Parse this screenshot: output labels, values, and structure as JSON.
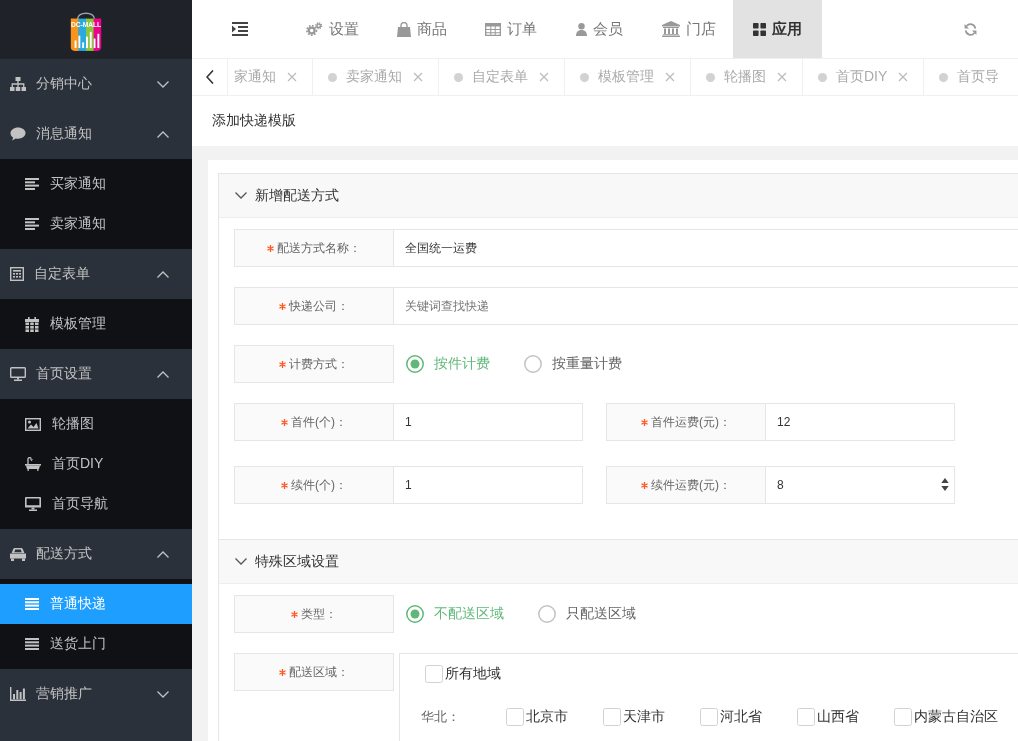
{
  "logo": {
    "text": "DC-MALL"
  },
  "sidebar": {
    "groups": [
      {
        "label": "分销中心",
        "expanded": false
      },
      {
        "label": "消息通知",
        "expanded": true,
        "children": [
          {
            "label": "买家通知",
            "selected": false
          },
          {
            "label": "卖家通知",
            "selected": false
          }
        ]
      },
      {
        "label": "自定表单",
        "expanded": true,
        "children": [
          {
            "label": "模板管理",
            "selected": false
          }
        ]
      },
      {
        "label": "首页设置",
        "expanded": true,
        "children": [
          {
            "label": "轮播图",
            "selected": false
          },
          {
            "label": "首页DIY",
            "selected": false
          },
          {
            "label": "首页导航",
            "selected": false
          }
        ]
      },
      {
        "label": "配送方式",
        "expanded": true,
        "children": [
          {
            "label": "普通快递",
            "selected": true
          },
          {
            "label": "送货上门",
            "selected": false
          }
        ]
      },
      {
        "label": "营销推广",
        "expanded": false
      }
    ]
  },
  "topnav": {
    "items": [
      {
        "label": "设置",
        "selected": false
      },
      {
        "label": "商品",
        "selected": false
      },
      {
        "label": "订单",
        "selected": false
      },
      {
        "label": "会员",
        "selected": false
      },
      {
        "label": "门店",
        "selected": false
      },
      {
        "label": "应用",
        "selected": true
      }
    ]
  },
  "tabs": [
    {
      "kind": "cut-left",
      "label": "家通知",
      "selected": false
    },
    {
      "kind": "full",
      "label": "卖家通知",
      "selected": false
    },
    {
      "kind": "full",
      "label": "自定表单",
      "selected": false
    },
    {
      "kind": "full",
      "label": "模板管理",
      "selected": false
    },
    {
      "kind": "full",
      "label": "轮播图",
      "selected": false
    },
    {
      "kind": "full",
      "label": "首页DIY",
      "selected": false
    },
    {
      "kind": "cut-right",
      "label": "首页导",
      "selected": false
    }
  ],
  "breadcrumb": "添加快递模版",
  "panels": [
    {
      "title": "新增配送方式",
      "expanded": true,
      "fields": [
        {
          "kind": "text",
          "label": "配送方式名称：",
          "required": true,
          "value": "全国统一运费"
        },
        {
          "kind": "text",
          "label": "快递公司：",
          "required": true,
          "placeholder": "关键词查找快递"
        },
        {
          "kind": "radio",
          "label": "计费方式：",
          "required": true,
          "options": [
            {
              "label": "按件计费",
              "selected": true
            },
            {
              "label": "按重量计费",
              "selected": false
            }
          ]
        },
        {
          "kind": "pair",
          "items": [
            {
              "label": "首件(个)：",
              "required": true,
              "value": "1",
              "stepper": false
            },
            {
              "label": "首件运费(元)：",
              "required": true,
              "value": "12",
              "stepper": false
            }
          ]
        },
        {
          "kind": "pair",
          "items": [
            {
              "label": "续件(个)：",
              "required": true,
              "value": "1",
              "stepper": false
            },
            {
              "label": "续件运费(元)：",
              "required": true,
              "value": "8",
              "stepper": true
            }
          ]
        }
      ]
    },
    {
      "title": "特殊区域设置",
      "expanded": true,
      "fields": [
        {
          "kind": "radio",
          "label": "类型：",
          "required": true,
          "options": [
            {
              "label": "不配送区域",
              "selected": true
            },
            {
              "label": "只配送区域",
              "selected": false
            }
          ]
        },
        {
          "kind": "regions",
          "label": "配送区域：",
          "required": true,
          "all": {
            "label": "所有地域",
            "checked": false
          },
          "groups": [
            {
              "name": "华北：",
              "options": [
                {
                  "label": "北京市",
                  "checked": false
                },
                {
                  "label": "天津市",
                  "checked": false
                },
                {
                  "label": "河北省",
                  "checked": false
                },
                {
                  "label": "山西省",
                  "checked": false
                },
                {
                  "label": "内蒙古自治区",
                  "checked": false
                }
              ]
            }
          ]
        }
      ]
    }
  ]
}
